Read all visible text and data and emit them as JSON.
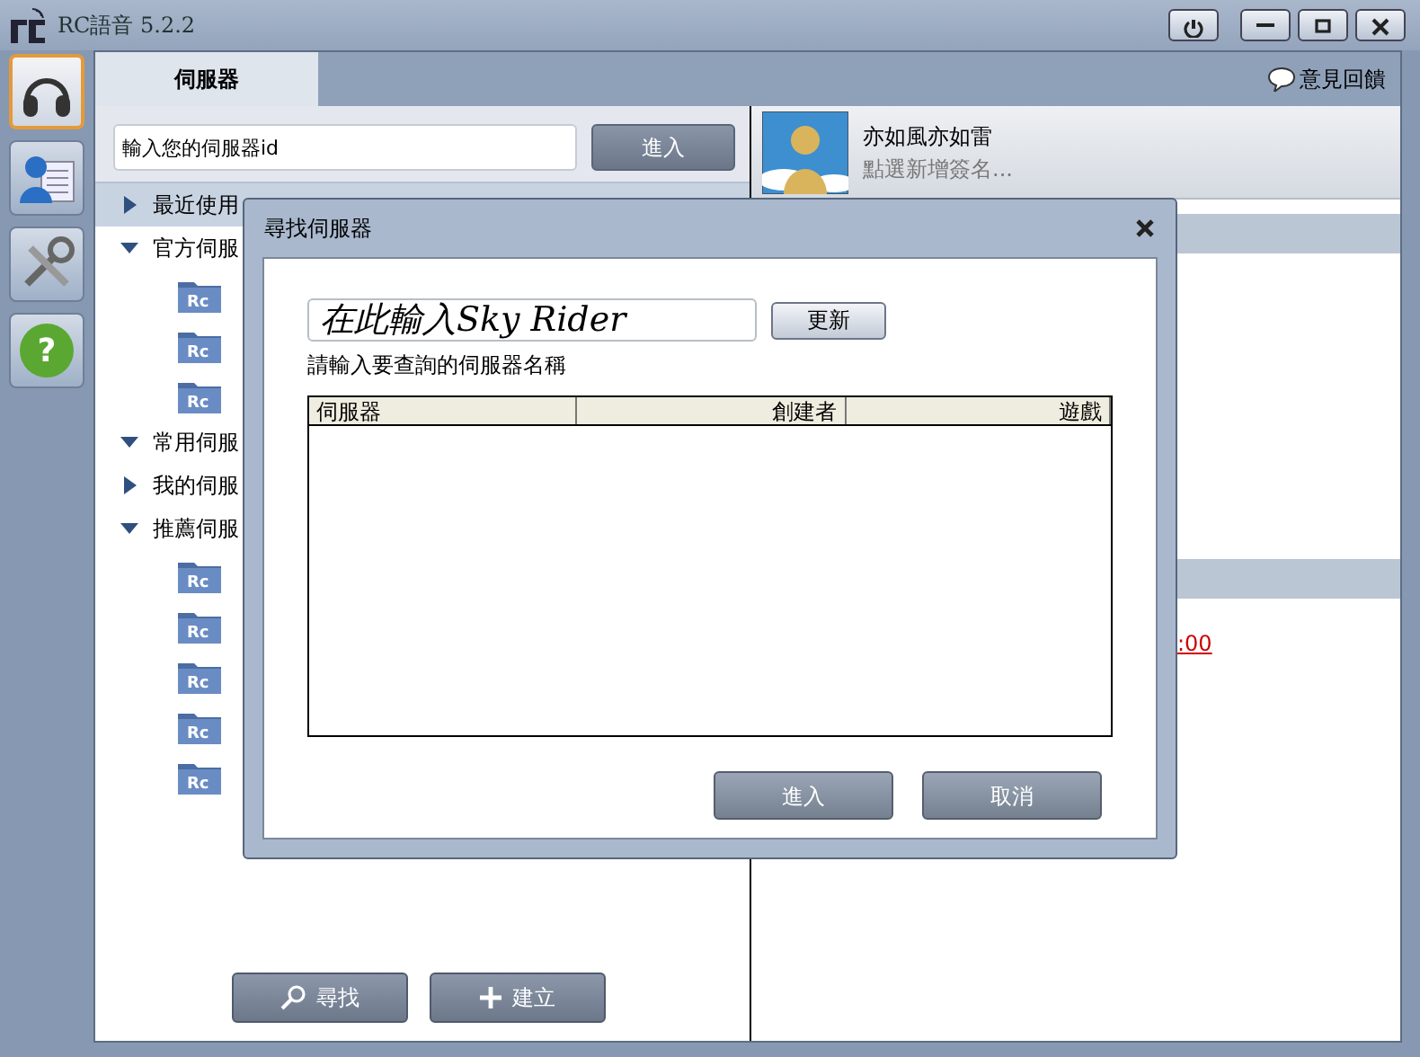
{
  "window": {
    "title": "RC語音 5.2.2"
  },
  "rail": [
    {
      "kind": "headphones",
      "selected": true
    },
    {
      "kind": "contacts",
      "selected": false
    },
    {
      "kind": "tools",
      "selected": false
    },
    {
      "kind": "help",
      "label": "?",
      "selected": false
    }
  ],
  "tabs": [
    {
      "label": "伺服器",
      "selected": true
    }
  ],
  "feedback": "意見回饋",
  "server_search": {
    "value": "輸入您的伺服器id",
    "button": "進入"
  },
  "tree": [
    {
      "label": "最近使用",
      "expanded": false,
      "selected": true
    },
    {
      "label": "官方伺服",
      "expanded": true,
      "selected": false,
      "children": [
        {
          "icon_text": "Rc"
        },
        {
          "icon_text": "Rc"
        },
        {
          "icon_text": "Rc"
        }
      ]
    },
    {
      "label": "常用伺服",
      "expanded": true,
      "selected": false
    },
    {
      "label": "我的伺服",
      "expanded": false,
      "selected": false
    },
    {
      "label": "推薦伺服",
      "expanded": true,
      "selected": false,
      "children": [
        {
          "icon_text": "Rc"
        },
        {
          "icon_text": "Rc"
        },
        {
          "icon_text": "Rc"
        },
        {
          "icon_text": "Rc"
        },
        {
          "icon_text": "Rc"
        }
      ]
    }
  ],
  "bottom_buttons": [
    {
      "kind": "search",
      "label": "尋找"
    },
    {
      "kind": "add",
      "label": "建立"
    }
  ],
  "profile": {
    "name": "亦如風亦如雷",
    "signature": "點選新增簽名..."
  },
  "right_link": ":00",
  "dialog": {
    "title": "尋找伺服器",
    "input_value": "在此輸入Sky Rider",
    "refresh": "更新",
    "hint": "請輸入要查詢的伺服器名稱",
    "table": {
      "columns": [
        "伺服器",
        "創建者",
        "遊戲"
      ]
    },
    "buttons": [
      "進入",
      "取消"
    ]
  }
}
